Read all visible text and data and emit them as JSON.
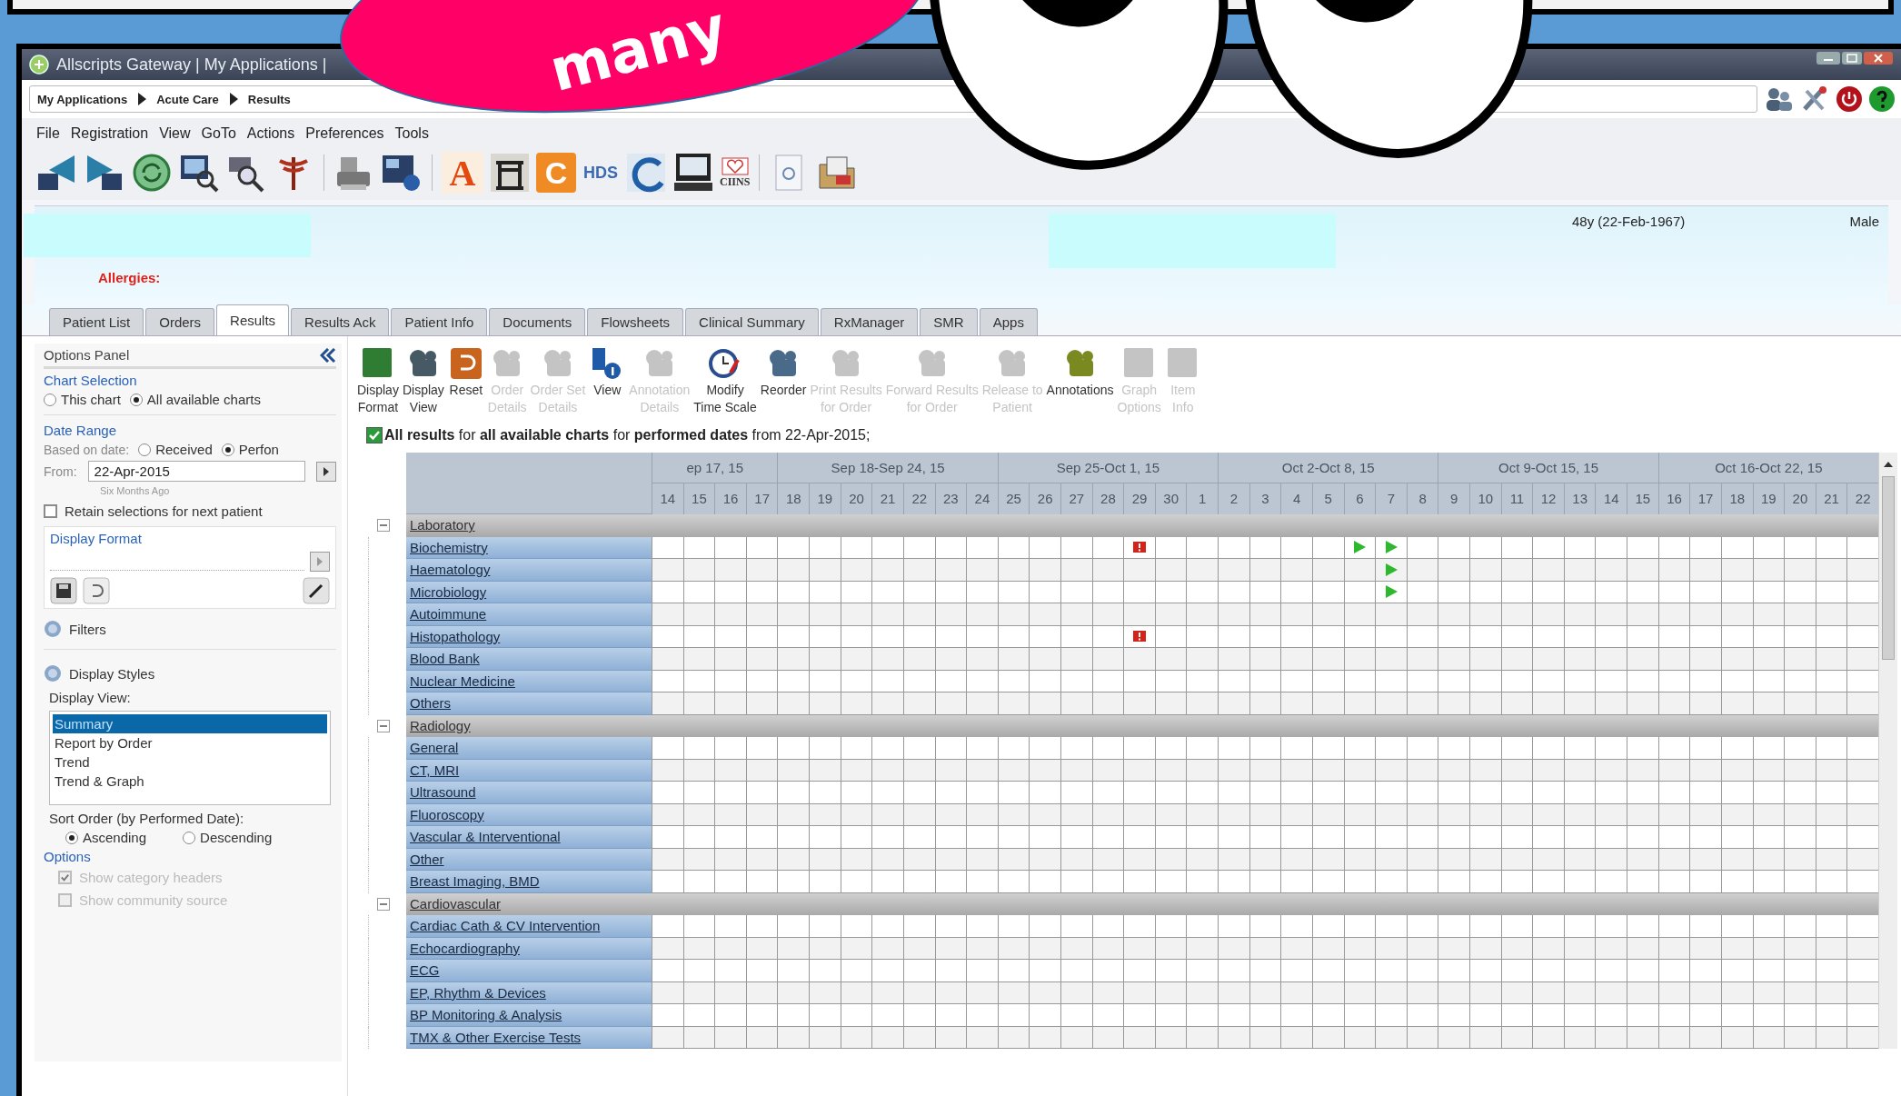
{
  "window": {
    "title": "Allscripts Gateway | My Applications |"
  },
  "breadcrumb": [
    "My Applications",
    "Acute Care",
    "Results"
  ],
  "menu": [
    "File",
    "Registration",
    "View",
    "GoTo",
    "Actions",
    "Preferences",
    "Tools"
  ],
  "toolbar": [
    {
      "kind": "arrow-left"
    },
    {
      "kind": "arrow-right"
    },
    {
      "kind": "refresh"
    },
    {
      "kind": "monitor-search"
    },
    {
      "kind": "search"
    },
    {
      "kind": "caduceus"
    },
    {
      "kind": "separator"
    },
    {
      "kind": "printer"
    },
    {
      "kind": "card"
    },
    {
      "kind": "separator"
    },
    {
      "kind": "letter",
      "text": "A"
    },
    {
      "kind": "gate"
    },
    {
      "kind": "tile",
      "text": "C"
    },
    {
      "kind": "text",
      "text": "HDS"
    },
    {
      "kind": "swirl"
    },
    {
      "kind": "monitor"
    },
    {
      "kind": "heart",
      "text": "CIINS"
    },
    {
      "kind": "separator"
    },
    {
      "kind": "document"
    },
    {
      "kind": "folder"
    }
  ],
  "patient": {
    "allergies_label": "Allergies:",
    "age": "48y (22-Feb-1967)",
    "sex": "Male"
  },
  "tabs": [
    {
      "label": "Patient List",
      "selected": false
    },
    {
      "label": "Orders",
      "selected": false
    },
    {
      "label": "Results",
      "selected": true
    },
    {
      "label": "Results Ack",
      "selected": false
    },
    {
      "label": "Patient Info",
      "selected": false
    },
    {
      "label": "Documents",
      "selected": false
    },
    {
      "label": "Flowsheets",
      "selected": false
    },
    {
      "label": "Clinical Summary",
      "selected": false
    },
    {
      "label": "RxManager",
      "selected": false
    },
    {
      "label": "SMR",
      "selected": false
    },
    {
      "label": "Apps",
      "selected": false
    }
  ],
  "options_panel": {
    "title": "Options Panel",
    "chart_selection": {
      "heading": "Chart Selection",
      "options": [
        {
          "label": "This chart",
          "selected": false
        },
        {
          "label": "All available charts",
          "selected": true
        }
      ]
    },
    "date_range": {
      "heading": "Date Range",
      "based_on_label": "Based on date:",
      "options": [
        {
          "label": "Received",
          "selected": false
        },
        {
          "label": "Perfon",
          "selected": true
        }
      ],
      "from_label": "From:",
      "from_value": "22-Apr-2015",
      "from_hint": "Six Months Ago"
    },
    "retain": {
      "label": "Retain selections for next patient",
      "checked": false
    },
    "display_format": {
      "heading": "Display Format"
    },
    "filters": {
      "label": "Filters"
    },
    "display_styles": {
      "label": "Display Styles"
    },
    "display_view": {
      "label": "Display View:",
      "items": [
        {
          "label": "Summary",
          "selected": true
        },
        {
          "label": "Report by Order",
          "selected": false
        },
        {
          "label": "Trend",
          "selected": false
        },
        {
          "label": "Trend & Graph",
          "selected": false
        }
      ]
    },
    "sort_order": {
      "label": "Sort Order (by Performed Date):",
      "options": [
        {
          "label": "Ascending",
          "selected": true
        },
        {
          "label": "Descending",
          "selected": false
        }
      ]
    },
    "options": {
      "heading": "Options",
      "items": [
        {
          "label": "Show category headers",
          "checked": true,
          "disabled": true
        },
        {
          "label": "Show community source",
          "checked": false,
          "disabled": true
        }
      ]
    }
  },
  "results_toolbar": [
    {
      "label": "Display\nFormat",
      "kind": "format",
      "disabled": false
    },
    {
      "label": "Display\nView",
      "kind": "view",
      "disabled": false
    },
    {
      "label": "Reset",
      "kind": "reset",
      "disabled": false
    },
    {
      "label": "Order\nDetails",
      "kind": "stack",
      "disabled": true
    },
    {
      "label": "Order Set\nDetails",
      "kind": "stack",
      "disabled": true
    },
    {
      "label": "View",
      "kind": "info",
      "disabled": false
    },
    {
      "label": "Annotation\nDetails",
      "kind": "note",
      "disabled": true
    },
    {
      "label": "Modify\nTime Scale",
      "kind": "clock",
      "disabled": false
    },
    {
      "label": "Reorder",
      "kind": "reorder",
      "disabled": false
    },
    {
      "label": "Print Results\nfor Order",
      "kind": "stack",
      "disabled": true
    },
    {
      "label": "Forward Results\nfor Order",
      "kind": "forward",
      "disabled": true
    },
    {
      "label": "Release to\nPatient",
      "kind": "release",
      "disabled": true
    },
    {
      "label": "Annotations",
      "kind": "annotate",
      "disabled": false
    },
    {
      "label": "Graph\nOptions",
      "kind": "graph",
      "disabled": true
    },
    {
      "label": "Item\nInfo",
      "kind": "item",
      "disabled": true
    }
  ],
  "summary": {
    "checked": true,
    "text": "**All results** for **all available charts** for **performed dates** from 22-Apr-2015;"
  },
  "grid": {
    "weeks": [
      {
        "label": "ep 17, 15",
        "days": [
          "14",
          "15",
          "16",
          "17"
        ]
      },
      {
        "label": "Sep 18-Sep 24, 15",
        "days": [
          "18",
          "19",
          "20",
          "21",
          "22",
          "23",
          "24"
        ]
      },
      {
        "label": "Sep 25-Oct 1, 15",
        "days": [
          "25",
          "26",
          "27",
          "28",
          "29",
          "30",
          "1"
        ]
      },
      {
        "label": "Oct 2-Oct 8, 15",
        "days": [
          "2",
          "3",
          "4",
          "5",
          "6",
          "7",
          "8"
        ]
      },
      {
        "label": "Oct 9-Oct 15, 15",
        "days": [
          "9",
          "10",
          "11",
          "12",
          "13",
          "14",
          "15"
        ]
      },
      {
        "label": "Oct 16-Oct 22, 15",
        "days": [
          "16",
          "17",
          "18",
          "19",
          "20",
          "21",
          "22"
        ]
      }
    ],
    "groups": [
      {
        "label": "Laboratory",
        "expanded": true,
        "children": [
          {
            "label": "Biochemistry",
            "cells": [
              {
                "kind": "empty"
              },
              {
                "kind": "empty"
              },
              {
                "kind": "empty"
              },
              {
                "kind": "empty"
              },
              {
                "kind": "empty"
              },
              {
                "kind": "empty"
              },
              {
                "kind": "empty"
              },
              {
                "kind": "empty"
              },
              {
                "kind": "empty"
              },
              {
                "kind": "empty"
              },
              {
                "kind": "empty"
              },
              {
                "kind": "empty"
              },
              {
                "kind": "empty"
              },
              {
                "kind": "empty"
              },
              {
                "kind": "empty"
              },
              {
                "kind": "flag"
              },
              {
                "kind": "empty"
              },
              {
                "kind": "empty"
              },
              {
                "kind": "empty"
              },
              {
                "kind": "empty"
              },
              {
                "kind": "empty"
              },
              {
                "kind": "empty"
              },
              {
                "kind": "arrow"
              },
              {
                "kind": "arrow"
              },
              {
                "kind": "empty"
              },
              {
                "kind": "empty"
              },
              {
                "kind": "empty"
              },
              {
                "kind": "empty"
              },
              {
                "kind": "empty"
              },
              {
                "kind": "empty"
              },
              {
                "kind": "empty"
              },
              {
                "kind": "empty"
              },
              {
                "kind": "empty"
              },
              {
                "kind": "empty"
              },
              {
                "kind": "empty"
              },
              {
                "kind": "empty"
              },
              {
                "kind": "empty"
              },
              {
                "kind": "empty"
              },
              {
                "kind": "empty"
              }
            ]
          },
          {
            "label": "Haematology",
            "cells": [
              {
                "kind": "empty"
              },
              {
                "kind": "empty"
              },
              {
                "kind": "empty"
              },
              {
                "kind": "empty"
              },
              {
                "kind": "empty"
              },
              {
                "kind": "empty"
              },
              {
                "kind": "empty"
              },
              {
                "kind": "empty"
              },
              {
                "kind": "empty"
              },
              {
                "kind": "empty"
              },
              {
                "kind": "empty"
              },
              {
                "kind": "empty"
              },
              {
                "kind": "empty"
              },
              {
                "kind": "empty"
              },
              {
                "kind": "empty"
              },
              {
                "kind": "empty"
              },
              {
                "kind": "empty"
              },
              {
                "kind": "empty"
              },
              {
                "kind": "empty"
              },
              {
                "kind": "empty"
              },
              {
                "kind": "empty"
              },
              {
                "kind": "empty"
              },
              {
                "kind": "empty"
              },
              {
                "kind": "arrow"
              },
              {
                "kind": "empty"
              },
              {
                "kind": "empty"
              },
              {
                "kind": "empty"
              },
              {
                "kind": "empty"
              },
              {
                "kind": "empty"
              },
              {
                "kind": "empty"
              },
              {
                "kind": "empty"
              },
              {
                "kind": "empty"
              },
              {
                "kind": "empty"
              },
              {
                "kind": "empty"
              },
              {
                "kind": "empty"
              },
              {
                "kind": "empty"
              },
              {
                "kind": "empty"
              },
              {
                "kind": "empty"
              },
              {
                "kind": "empty"
              }
            ]
          },
          {
            "label": "Microbiology",
            "cells": [
              {
                "kind": "empty"
              },
              {
                "kind": "empty"
              },
              {
                "kind": "empty"
              },
              {
                "kind": "empty"
              },
              {
                "kind": "empty"
              },
              {
                "kind": "empty"
              },
              {
                "kind": "empty"
              },
              {
                "kind": "empty"
              },
              {
                "kind": "empty"
              },
              {
                "kind": "empty"
              },
              {
                "kind": "empty"
              },
              {
                "kind": "empty"
              },
              {
                "kind": "empty"
              },
              {
                "kind": "empty"
              },
              {
                "kind": "empty"
              },
              {
                "kind": "empty"
              },
              {
                "kind": "empty"
              },
              {
                "kind": "empty"
              },
              {
                "kind": "empty"
              },
              {
                "kind": "empty"
              },
              {
                "kind": "empty"
              },
              {
                "kind": "empty"
              },
              {
                "kind": "empty"
              },
              {
                "kind": "arrow"
              },
              {
                "kind": "empty"
              },
              {
                "kind": "empty"
              },
              {
                "kind": "empty"
              },
              {
                "kind": "empty"
              },
              {
                "kind": "empty"
              },
              {
                "kind": "empty"
              },
              {
                "kind": "empty"
              },
              {
                "kind": "empty"
              },
              {
                "kind": "empty"
              },
              {
                "kind": "empty"
              },
              {
                "kind": "empty"
              },
              {
                "kind": "empty"
              },
              {
                "kind": "empty"
              },
              {
                "kind": "empty"
              },
              {
                "kind": "empty"
              }
            ]
          },
          {
            "label": "Autoimmune"
          },
          {
            "label": "Histopathology",
            "cells": [
              {
                "kind": "empty"
              },
              {
                "kind": "empty"
              },
              {
                "kind": "empty"
              },
              {
                "kind": "empty"
              },
              {
                "kind": "empty"
              },
              {
                "kind": "empty"
              },
              {
                "kind": "empty"
              },
              {
                "kind": "empty"
              },
              {
                "kind": "empty"
              },
              {
                "kind": "empty"
              },
              {
                "kind": "empty"
              },
              {
                "kind": "empty"
              },
              {
                "kind": "empty"
              },
              {
                "kind": "empty"
              },
              {
                "kind": "empty"
              },
              {
                "kind": "flag"
              },
              {
                "kind": "empty"
              },
              {
                "kind": "empty"
              },
              {
                "kind": "empty"
              },
              {
                "kind": "empty"
              },
              {
                "kind": "empty"
              },
              {
                "kind": "empty"
              },
              {
                "kind": "empty"
              },
              {
                "kind": "empty"
              },
              {
                "kind": "empty"
              },
              {
                "kind": "empty"
              },
              {
                "kind": "empty"
              },
              {
                "kind": "empty"
              },
              {
                "kind": "empty"
              },
              {
                "kind": "empty"
              },
              {
                "kind": "empty"
              },
              {
                "kind": "empty"
              },
              {
                "kind": "empty"
              },
              {
                "kind": "empty"
              },
              {
                "kind": "empty"
              },
              {
                "kind": "empty"
              },
              {
                "kind": "empty"
              },
              {
                "kind": "empty"
              },
              {
                "kind": "empty"
              }
            ]
          },
          {
            "label": "Blood Bank"
          },
          {
            "label": "Nuclear Medicine"
          },
          {
            "label": "Others"
          }
        ]
      },
      {
        "label": "Radiology",
        "expanded": true,
        "children": [
          {
            "label": "General"
          },
          {
            "label": "CT, MRI"
          },
          {
            "label": "Ultrasound"
          },
          {
            "label": "Fluoroscopy"
          },
          {
            "label": "Vascular & Interventional"
          },
          {
            "label": "Other"
          },
          {
            "label": "Breast Imaging, BMD"
          }
        ]
      },
      {
        "label": "Cardiovascular",
        "expanded": true,
        "children": [
          {
            "label": "Cardiac Cath & CV Intervention"
          },
          {
            "label": "Echocardiography"
          },
          {
            "label": "ECG"
          },
          {
            "label": "EP, Rhythm & Devices"
          },
          {
            "label": "BP Monitoring & Analysis"
          },
          {
            "label": "TMX & Other Exercise Tests"
          }
        ]
      }
    ]
  },
  "overlay": {
    "bubble_text": "many"
  }
}
